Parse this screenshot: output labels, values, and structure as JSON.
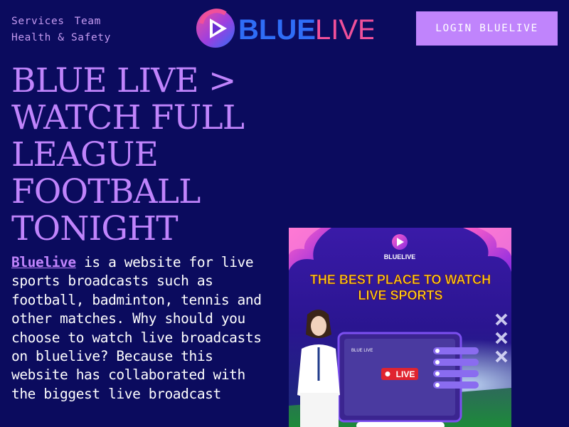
{
  "nav": {
    "links": [
      "Services",
      "Team",
      "Health & Safety"
    ]
  },
  "logo": {
    "text_blue": "BLUE",
    "text_live": "LIVE"
  },
  "login_button": "LOGIN BLUELIVE",
  "headline": "BLUE LIVE > WATCH FULL LEAGUE FOOTBALL TONIGHT",
  "intro": {
    "link_text": "Bluelive",
    "text": " is a website for live sports broadcasts such as football, badminton, tennis and other matches. Why should you choose to watch live broadcasts on bluelive? Because this website has collaborated with the biggest live broadcast"
  },
  "banner": {
    "logo_text": "BLUELIVE",
    "title_line1": "THE BEST PLACE TO WATCH",
    "title_line2": "LIVE SPORTS",
    "live_badge": "LIVE",
    "screen_logo_text": "BLUE LIVE"
  },
  "colors": {
    "background": "#0b0b5e",
    "accent": "#c084fc",
    "logo_blue": "#2f6df6",
    "logo_pink": "#f0509a",
    "banner_yellow": "#ffd21f",
    "live_red": "#e0242f"
  }
}
